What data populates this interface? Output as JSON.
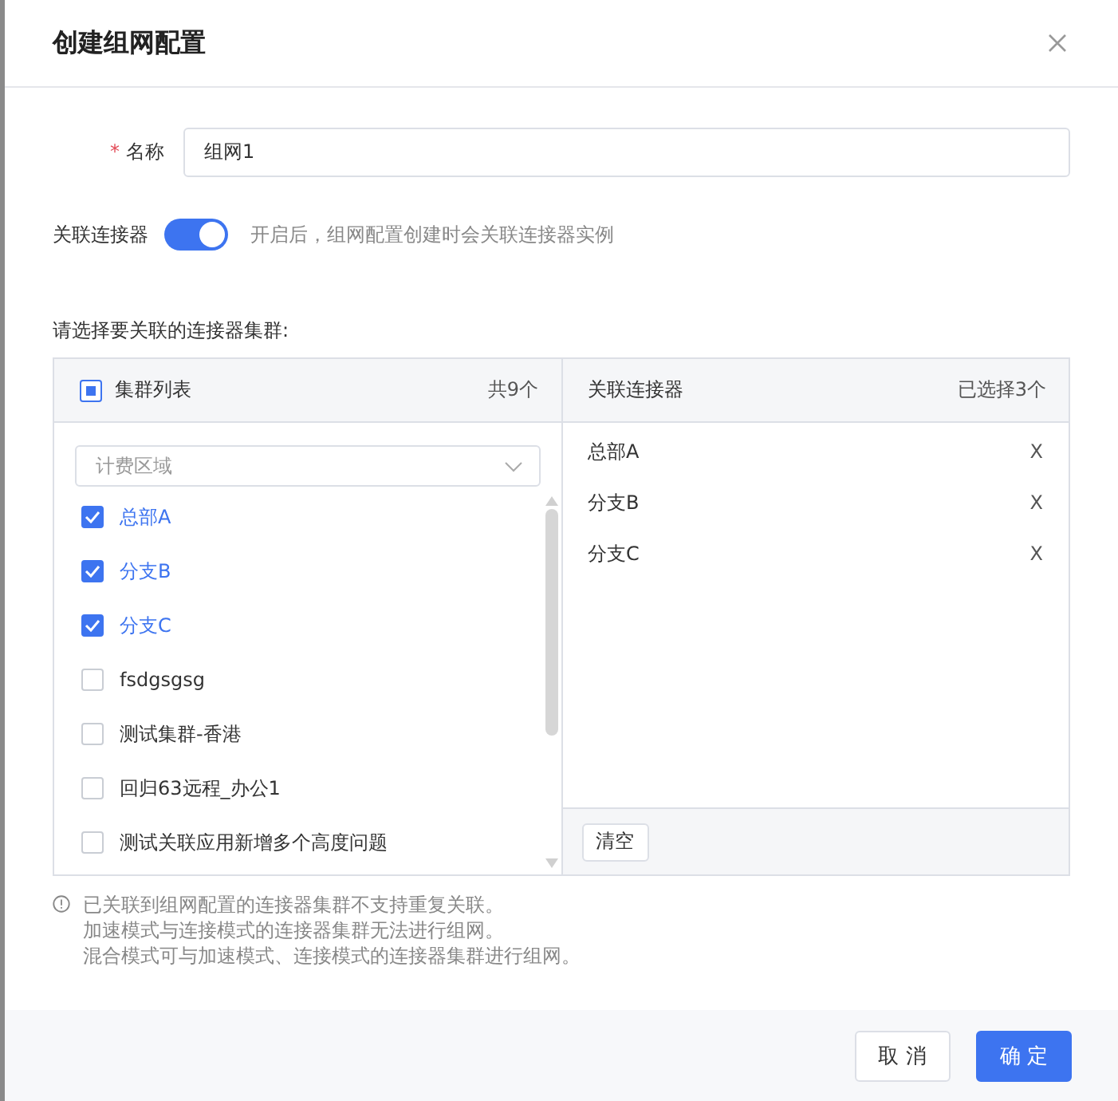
{
  "dialog": {
    "title": "创建组网配置"
  },
  "name_field": {
    "label": "名称",
    "required_mark": "*",
    "value": "组网1"
  },
  "link_toggle": {
    "label": "关联连接器",
    "on": true,
    "hint": "开启后，组网配置创建时会关联连接器实例"
  },
  "section_label": "请选择要关联的连接器集群:",
  "cluster_list": {
    "title": "集群列表",
    "indeterminate": true,
    "count": "共9个",
    "filter_placeholder": "计费区域",
    "items": [
      {
        "label": "总部A",
        "checked": true
      },
      {
        "label": "分支B",
        "checked": true
      },
      {
        "label": "分支C",
        "checked": true
      },
      {
        "label": "fsdgsgsg",
        "checked": false
      },
      {
        "label": "测试集群-香港",
        "checked": false
      },
      {
        "label": "回归63远程_办公1",
        "checked": false
      },
      {
        "label": "测试关联应用新增多个高度问题",
        "checked": false
      }
    ]
  },
  "selected_list": {
    "title": "关联连接器",
    "count": "已选择3个",
    "items": [
      {
        "label": "总部A",
        "remove": "X"
      },
      {
        "label": "分支B",
        "remove": "X"
      },
      {
        "label": "分支C",
        "remove": "X"
      }
    ],
    "clear_button": "清空"
  },
  "notes": [
    "已关联到组网配置的连接器集群不支持重复关联。",
    "加速模式与连接模式的连接器集群无法进行组网。",
    "混合模式可与加速模式、连接模式的连接器集群进行组网。"
  ],
  "buttons": [
    {
      "label": "取 消",
      "kind": "default"
    },
    {
      "label": "确 定",
      "kind": "primary"
    }
  ]
}
